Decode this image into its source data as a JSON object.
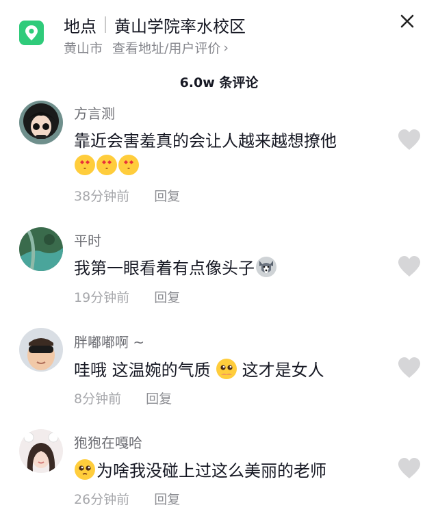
{
  "location": {
    "prefix": "地点",
    "name": "黄山学院率水校区",
    "city": "黄山市",
    "link": "查看地址/用户评价",
    "chevron": "›"
  },
  "comment_count_label": "6.0w 条评论",
  "close_icon_glyph": "✕",
  "colors": {
    "accent_green": "#2fcb7a",
    "heart_grey": "#d6d6d8"
  },
  "comments": [
    {
      "username": "方言测",
      "text": "靠近会害羞真的会让人越来越想撩他",
      "emojis": [
        "kissing-face-hearts-emoji",
        "kissing-face-hearts-emoji",
        "kissing-face-hearts-emoji"
      ],
      "time": "38分钟前",
      "reply": "回复"
    },
    {
      "username": "平时",
      "text": "我第一眼看着有点像头子",
      "emojis": [
        "husky-dog-emoji"
      ],
      "time": "19分钟前",
      "reply": "回复"
    },
    {
      "username": "胖嘟嘟啊 ~",
      "text_before": "哇哦 这温婉的气质",
      "text_after": "这才是女人",
      "emojis": [
        "pleading-face-emoji"
      ],
      "time": "8分钟前",
      "reply": "回复"
    },
    {
      "username": "狍狍在嘎哈",
      "text": "为啥我没碰上过这么美丽的老师",
      "emojis": [
        "pleading-face-emoji"
      ],
      "time": "26分钟前",
      "reply": "回复"
    }
  ]
}
